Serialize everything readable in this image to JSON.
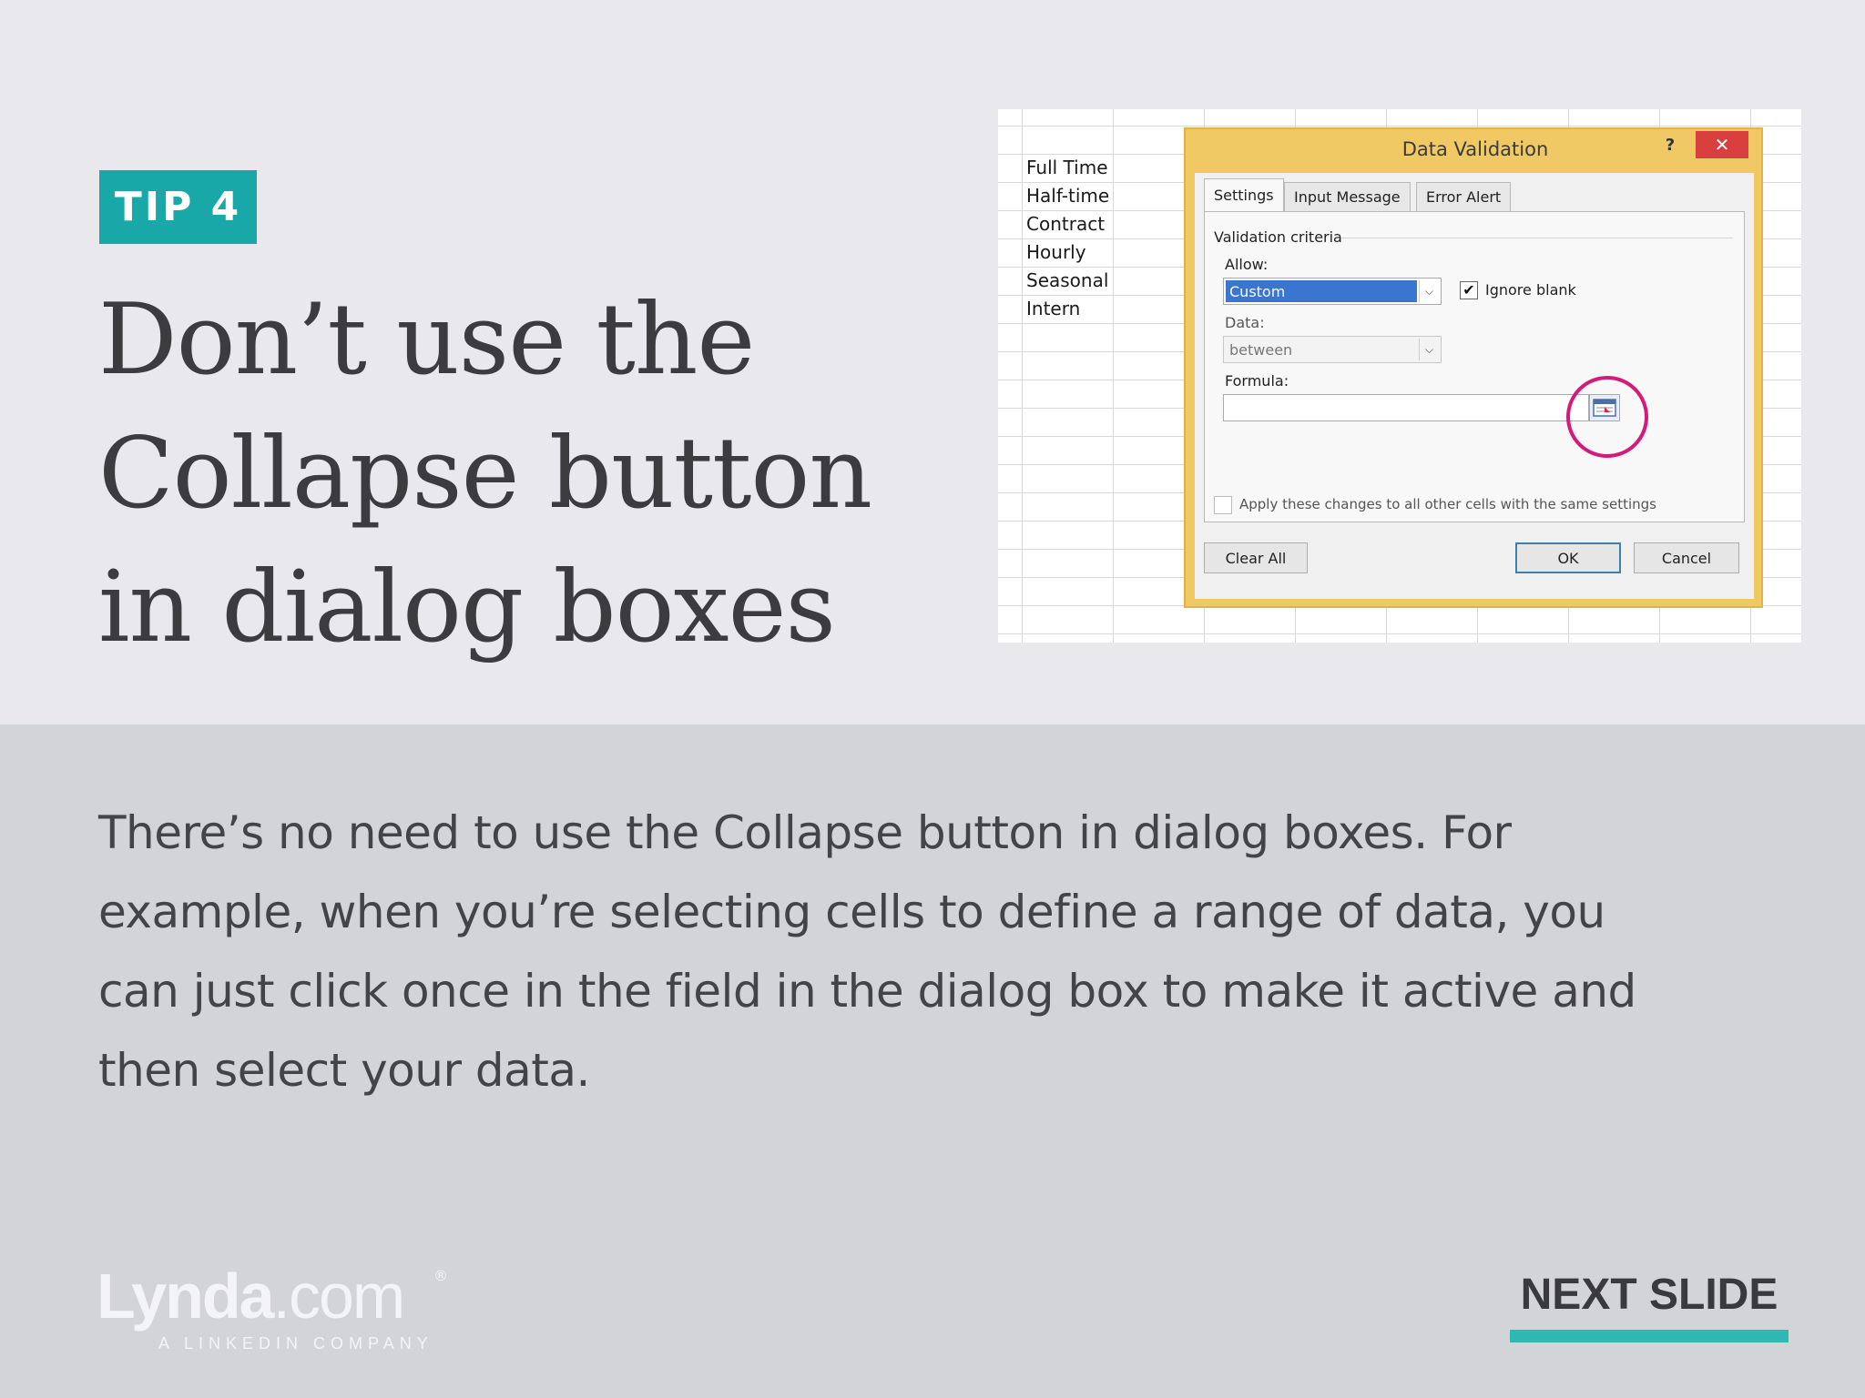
{
  "slide": {
    "tip_label": "TIP 4",
    "headline_lines": [
      "Don’t use the",
      "Collapse button",
      "in dialog boxes"
    ],
    "body_lines": [
      "There’s no need to use the Collapse button in dialog boxes. For",
      "example, when you’re selecting cells to define a range of data, you",
      "can just click once in the field in the dialog box to make it active and",
      "then select your data."
    ],
    "next_slide_label": "NEXT SLIDE"
  },
  "logo": {
    "brand_bold": "Lynda",
    "brand_light": ".com",
    "registered": "®",
    "tagline": "A LINKEDIN COMPANY"
  },
  "spreadsheet": {
    "cells": [
      "Full Time",
      "Half-time",
      "Contract",
      "Hourly",
      "Seasonal",
      "Intern"
    ]
  },
  "dialog": {
    "title": "Data Validation",
    "help_label": "?",
    "close_label": "✕",
    "tabs": [
      "Settings",
      "Input Message",
      "Error Alert"
    ],
    "validation_criteria_label": "Validation criteria",
    "allow_label": "Allow:",
    "allow_value": "Custom",
    "ignore_blank_label": "Ignore blank",
    "ignore_blank_checked": true,
    "data_label": "Data:",
    "data_value": "between",
    "formula_label": "Formula:",
    "formula_value": "",
    "apply_all_label": "Apply these changes to all other cells with the same settings",
    "clear_all_label": "Clear All",
    "ok_label": "OK",
    "cancel_label": "Cancel",
    "check_mark": "✔",
    "dropdown_arrow": "⌵"
  },
  "colors": {
    "tip_badge": "#19a8a8",
    "highlight_ring": "#d31b7a",
    "next_slide_underline": "#2fb7b4",
    "dialog_frame": "#f0c864"
  }
}
